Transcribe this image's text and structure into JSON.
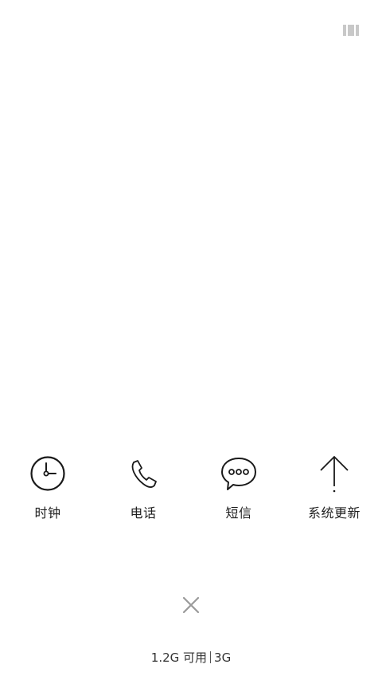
{
  "icons": {
    "top_right": "recents-menu-icon",
    "close": "close-icon"
  },
  "apps": [
    {
      "label": "时钟",
      "icon": "clock-icon"
    },
    {
      "label": "电话",
      "icon": "phone-icon"
    },
    {
      "label": "短信",
      "icon": "message-icon"
    },
    {
      "label": "系统更新",
      "icon": "system-update-icon"
    }
  ],
  "memory": {
    "available": "1.2G 可用",
    "total": "3G"
  },
  "colors": {
    "background": "#ffffff",
    "icon_stroke": "#1a1a1a",
    "close_icon": "#9a9a9a",
    "menu_icon": "#c8c8c8"
  }
}
